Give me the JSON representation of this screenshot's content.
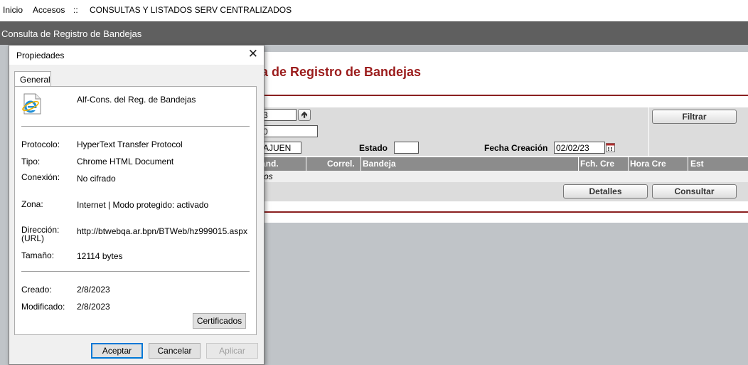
{
  "menu": {
    "inicio": "Inicio",
    "accesos": "Accesos",
    "sep": "::",
    "section": "CONSULTAS Y LISTADOS SERV CENTRALIZADOS"
  },
  "page_title": "Consulta de Registro de Bandejas",
  "panel": {
    "title": "a de Registro de Bandejas",
    "fields": {
      "f1": "3",
      "f2": "0",
      "f3": "AJUEN",
      "estado": "",
      "fecha": "02/02/23"
    },
    "labels": {
      "estado": "Estado",
      "fecha": "Fecha Creación"
    },
    "buttons": {
      "filtrar": "Filtrar",
      "detalles": "Detalles",
      "consultar": "Consultar"
    },
    "columns": [
      "and.",
      "Correl.",
      "Bandeja",
      "Fch. Cre",
      "Hora Cre",
      "Est"
    ],
    "row_text": "ros"
  },
  "dialog": {
    "title": "Propiedades",
    "tab": "General",
    "name": "Alf-Cons. del Reg. de Bandejas",
    "props": [
      {
        "label": "Protocolo:",
        "value": "HyperText Transfer Protocol"
      },
      {
        "label": "Tipo:",
        "value": "Chrome HTML Document"
      },
      {
        "label": "Conexión:",
        "value": "No cifrado"
      },
      {
        "label": "Zona:",
        "value": "Internet | Modo protegido: activado"
      },
      {
        "label": "Dirección:",
        "label2": "(URL)",
        "value": "http://btwebqa.ar.bpn/BTWeb/hz999015.aspx"
      },
      {
        "label": "Tamaño:",
        "value": "12114 bytes"
      },
      {
        "label": "Creado:",
        "value": "2/8/2023"
      },
      {
        "label": "Modificado:",
        "value": "2/8/2023"
      }
    ],
    "buttons": {
      "certificados": "Certificados",
      "aceptar": "Aceptar",
      "cancelar": "Cancelar",
      "aplicar": "Aplicar"
    }
  }
}
